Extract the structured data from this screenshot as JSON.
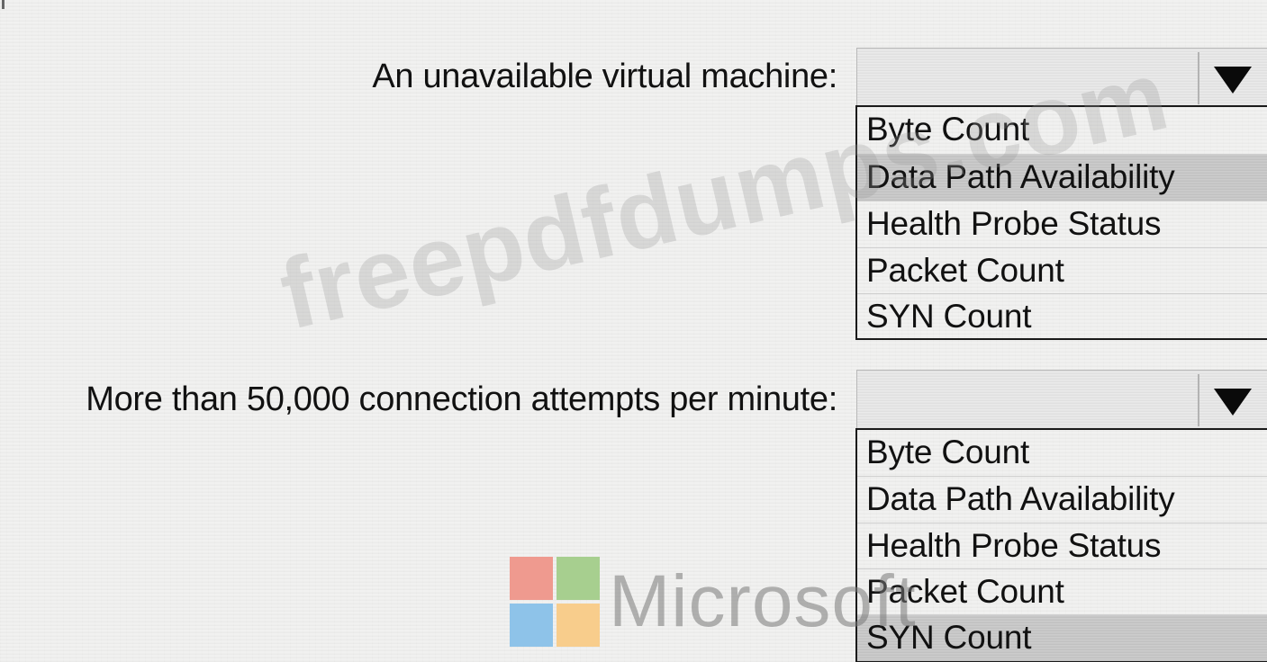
{
  "questions": [
    {
      "label": "An unavailable virtual machine:",
      "current_value": "",
      "options": [
        "Byte Count",
        "Data Path Availability",
        "Health Probe Status",
        "Packet Count",
        "SYN Count"
      ],
      "selected_option": "Data Path Availability"
    },
    {
      "label": "More than 50,000 connection attempts per minute:",
      "current_value": "",
      "options": [
        "Byte Count",
        "Data Path Availability",
        "Health Probe Status",
        "Packet Count",
        "SYN Count"
      ],
      "selected_option": "SYN Count"
    }
  ],
  "watermark": {
    "text": "freepdfdumps.com"
  },
  "logo": {
    "wordmark": "Microsoft",
    "colors": [
      "#ef9a8f",
      "#a7cf8f",
      "#8ec3e9",
      "#f8cd8c"
    ]
  },
  "icons": {
    "dropdown": "triangle-down-icon"
  }
}
